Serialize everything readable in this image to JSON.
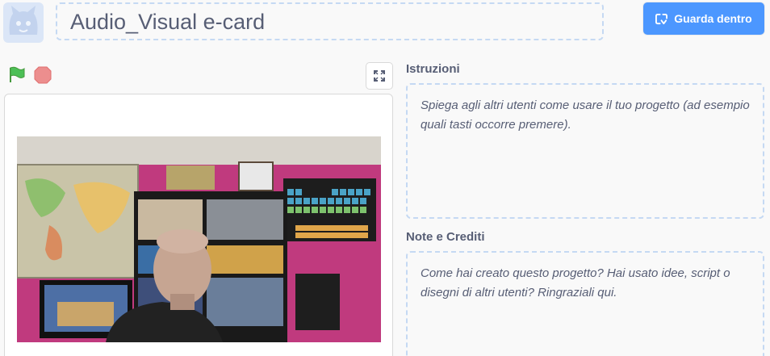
{
  "project": {
    "title": "Audio_Visual e-card"
  },
  "toolbar": {
    "see_inside_label": "Guarda dentro",
    "see_inside_icon": "remix-arrows-icon"
  },
  "stage_controls": {
    "green_flag_icon": "green-flag-icon",
    "stop_icon": "stop-sign-icon",
    "fullscreen_icon": "fullscreen-icon"
  },
  "instructions": {
    "label": "Istruzioni",
    "placeholder": "Spiega agli altri utenti come usare il tuo progetto (ad esempio quali tasti occorre premere)."
  },
  "notes": {
    "label": "Note e Crediti",
    "placeholder": "Come hai creato questo progetto? Hai usato idee, script o disegni di altri utenti? Ringraziali qui."
  },
  "colors": {
    "accent": "#4c97ff",
    "text": "#575e75",
    "dashed_border": "#c5d9f3",
    "flag": "#4cbf56",
    "stop": "#ec8e8e"
  }
}
